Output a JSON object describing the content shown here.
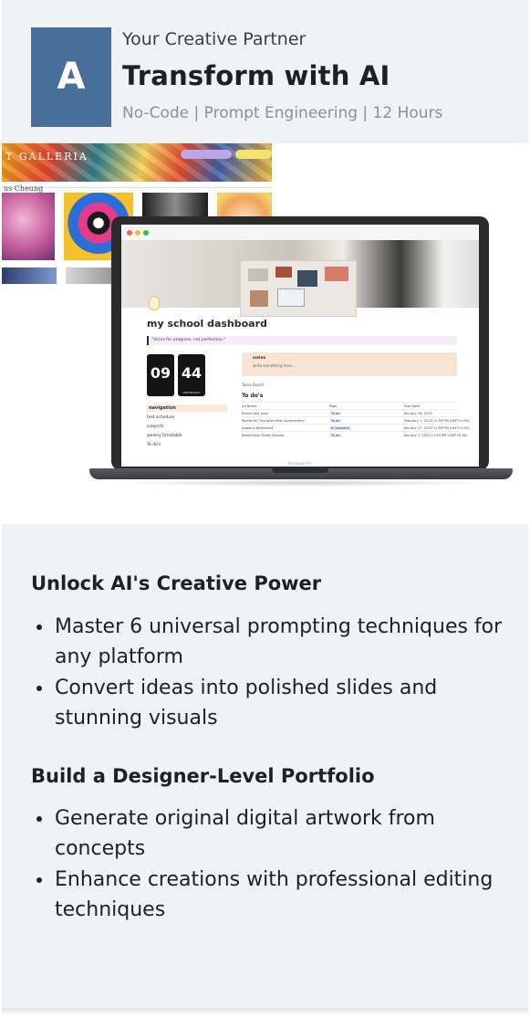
{
  "header": {
    "logo_letter": "A",
    "tagline": "Your Creative Partner",
    "title": "Transform with AI",
    "meta": "No-Code | Prompt Engineering | 12 Hours",
    "logo_color": "#4a6e9a"
  },
  "hero": {
    "gallery": {
      "title": "T GALLERIA",
      "subtitle": "us Cheung"
    },
    "laptop": {
      "brand_label": "MacBook Pro",
      "page_title": "my school dashboard",
      "quote": "\"strive for progress, not perfection.\"",
      "clock_hours": "09",
      "clock_minutes": "44",
      "clock_period": "WEDNESDAY",
      "navigation": {
        "heading": "navigation",
        "items": [
          "test schedule",
          "subjects",
          "weekly timetable",
          "To do's"
        ]
      },
      "notes": {
        "title": "notes",
        "subtitle": "write something here..."
      },
      "views": "Tasks   Board",
      "todo_title": "To do's",
      "table": {
        "headers": [
          "Aa Name",
          "Tags",
          "Due Date"
        ],
        "rows": [
          [
            "french test prep",
            "To do",
            "January 16, 2023"
          ],
          [
            "Poems by Charlotte Mew Commentary",
            "To do",
            "February 1, 2023 11:59 PM (GMT+0:30)"
          ],
          [
            "Algebra Worksheet",
            "In progress",
            "January 27, 2023 11:59 PM (GMT+0:30)"
          ],
          [
            "Read Initial Slides chapter",
            "To do",
            "January 7, 2023 11:59 PM (GMT+0:30)"
          ]
        ]
      }
    }
  },
  "sections": [
    {
      "title": "Unlock AI's Creative Power",
      "bullets": [
        "Master 6 universal prompting techniques for any platform",
        "Convert ideas into polished slides and stunning visuals"
      ]
    },
    {
      "title": "Build a Designer-Level Portfolio",
      "bullets": [
        "Generate original digital artwork from concepts",
        "Enhance creations with professional editing techniques"
      ]
    }
  ]
}
